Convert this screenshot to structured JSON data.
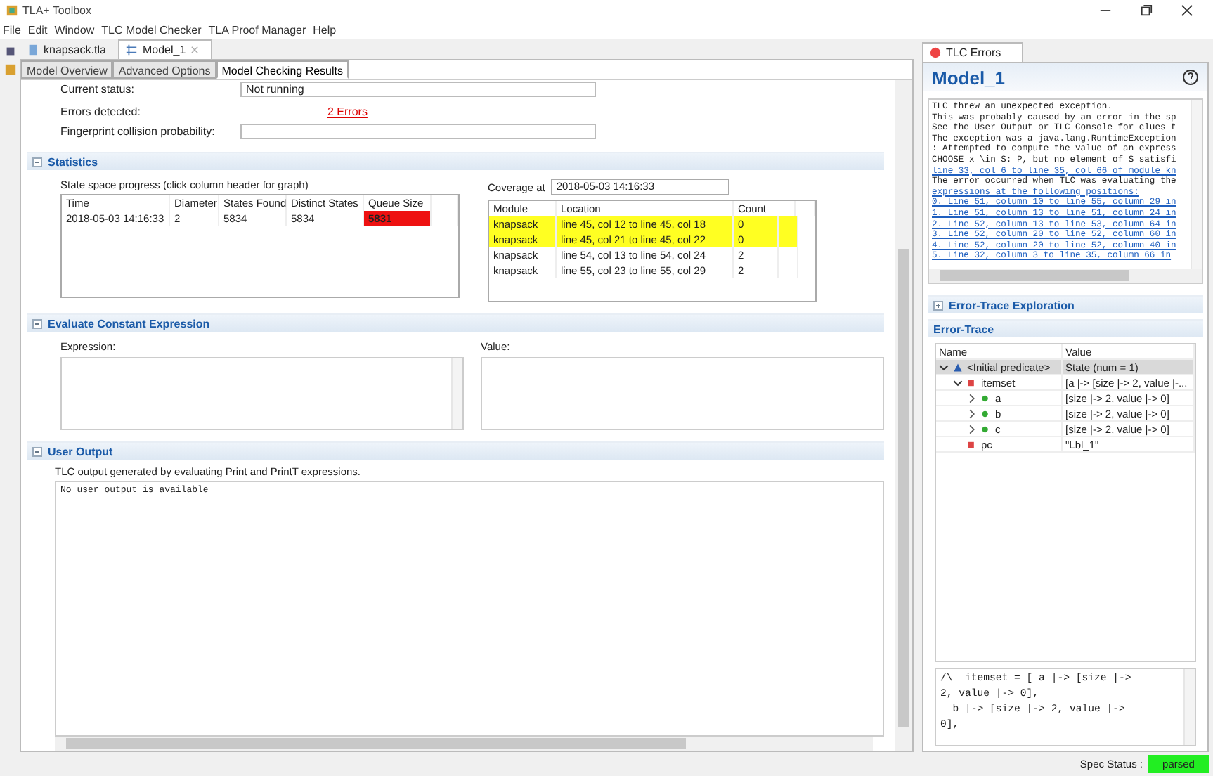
{
  "window": {
    "title": "TLA+ Toolbox"
  },
  "menu": [
    "File",
    "Edit",
    "Window",
    "TLC Model Checker",
    "TLA Proof Manager",
    "Help"
  ],
  "editor_tabs": [
    {
      "label": "knapsack.tla",
      "kind": "module",
      "selected": false
    },
    {
      "label": "Model_1",
      "kind": "model",
      "selected": true,
      "closable": true
    }
  ],
  "page_tabs": [
    {
      "label": "Model Overview",
      "selected": false
    },
    {
      "label": "Advanced Options",
      "selected": false
    },
    {
      "label": "Model Checking Results",
      "selected": true
    }
  ],
  "general": {
    "current_status_label": "Current status:",
    "current_status": "Not running",
    "errors_label": "Errors detected:",
    "errors_link": "2 Errors",
    "fingerprint_label": "Fingerprint collision probability:"
  },
  "statistics": {
    "title": "Statistics",
    "expanded": true,
    "progress_label": "State space progress (click column header for graph)",
    "columns": [
      "Time",
      "Diameter",
      "States Found",
      "Distinct States",
      "Queue Size"
    ],
    "rows": [
      {
        "cells": [
          "2018-05-03 14:16:33",
          "2",
          "5834",
          "5834",
          "5831"
        ],
        "queue_alert": true
      }
    ],
    "coverage_label": "Coverage at",
    "coverage_time": "2018-05-03 14:16:33",
    "coverage_columns": [
      "Module",
      "Location",
      "Count"
    ],
    "coverage_rows": [
      {
        "cells": [
          "knapsack",
          "line 45, col 12 to line 45, col 18",
          "0"
        ],
        "highlighted": true
      },
      {
        "cells": [
          "knapsack",
          "line 45, col 21 to line 45, col 22",
          "0"
        ],
        "highlighted": true
      },
      {
        "cells": [
          "knapsack",
          "line 54, col 13 to line 54, col 24",
          "2"
        ],
        "highlighted": false
      },
      {
        "cells": [
          "knapsack",
          "line 55, col 23 to line 55, col 29",
          "2"
        ],
        "highlighted": false
      }
    ]
  },
  "evaluate": {
    "title": "Evaluate Constant Expression",
    "expanded": true,
    "expression_label": "Expression:",
    "value_label": "Value:"
  },
  "user_output": {
    "title": "User Output",
    "expanded": true,
    "description": "TLC output generated by evaluating Print and PrintT expressions.",
    "text": "No user output is available"
  },
  "errors_view": {
    "tab": "TLC Errors",
    "title": "Model_1",
    "lines": [
      {
        "text": "TLC threw an unexpected exception.",
        "kind": "text"
      },
      {
        "text": "This was probably caused by an error in the sp",
        "kind": "text"
      },
      {
        "text": "See the User Output or TLC Console for clues t",
        "kind": "text"
      },
      {
        "text": "The exception was a java.lang.RuntimeException",
        "kind": "text"
      },
      {
        "text": ": Attempted to compute the value of an express",
        "kind": "text"
      },
      {
        "text": "CHOOSE x \\in S: P, but no element of S satisfi",
        "kind": "text"
      },
      {
        "text": "line 33, col 6 to line 35, col 66 of module kn",
        "kind": "link"
      },
      {
        "text": "The error occurred when TLC was evaluating the",
        "kind": "text"
      },
      {
        "text": "expressions at the following positions:",
        "kind": "link"
      },
      {
        "text": "0. Line 51, column 10 to line 55, column 29 in",
        "kind": "link"
      },
      {
        "text": "1. Line 51, column 13 to line 51, column 24 in",
        "kind": "link"
      },
      {
        "text": "2. Line 52, column 13 to line 53, column 64 in",
        "kind": "link"
      },
      {
        "text": "3. Line 52, column 20 to line 52, column 60 in",
        "kind": "link"
      },
      {
        "text": "4. Line 52, column 20 to line 52, column 40 in",
        "kind": "link"
      },
      {
        "text": "5. Line 32, column 3 to line 35, column 66 in",
        "kind": "link"
      }
    ],
    "exploration": {
      "title": "Error-Trace Exploration",
      "expanded": false
    },
    "trace": {
      "title": "Error-Trace",
      "columns": [
        "Name",
        "Value"
      ],
      "nodes": [
        {
          "name": "<Initial predicate>",
          "value": "State (num = 1)",
          "kind": "state",
          "expandable": true,
          "expanded": true,
          "selected": true,
          "children": [
            {
              "name": "itemset",
              "value": "[a |-> [size |-> 2, value |-...",
              "kind": "variable",
              "expandable": true,
              "expanded": true,
              "selected": false,
              "children": [
                {
                  "name": "a",
                  "value": "[size |-> 2, value |-> 0]",
                  "kind": "field",
                  "expandable": true,
                  "expanded": false,
                  "selected": false
                },
                {
                  "name": "b",
                  "value": "[size |-> 2, value |-> 0]",
                  "kind": "field",
                  "expandable": true,
                  "expanded": false,
                  "selected": false
                },
                {
                  "name": "c",
                  "value": "[size |-> 2, value |-> 0]",
                  "kind": "field",
                  "expandable": true,
                  "expanded": false,
                  "selected": false
                }
              ]
            },
            {
              "name": "pc",
              "value": "\"Lbl_1\"",
              "kind": "variable",
              "expandable": false,
              "selected": false
            }
          ]
        }
      ],
      "detail_lines": [
        "/\\  itemset = [ a |-> [size |->",
        "2, value |-> 0],",
        "  b |-> [size |-> 2, value |->",
        "0],"
      ]
    }
  },
  "status_bar": {
    "label": "Spec Status :",
    "status": "parsed",
    "ok": true
  }
}
